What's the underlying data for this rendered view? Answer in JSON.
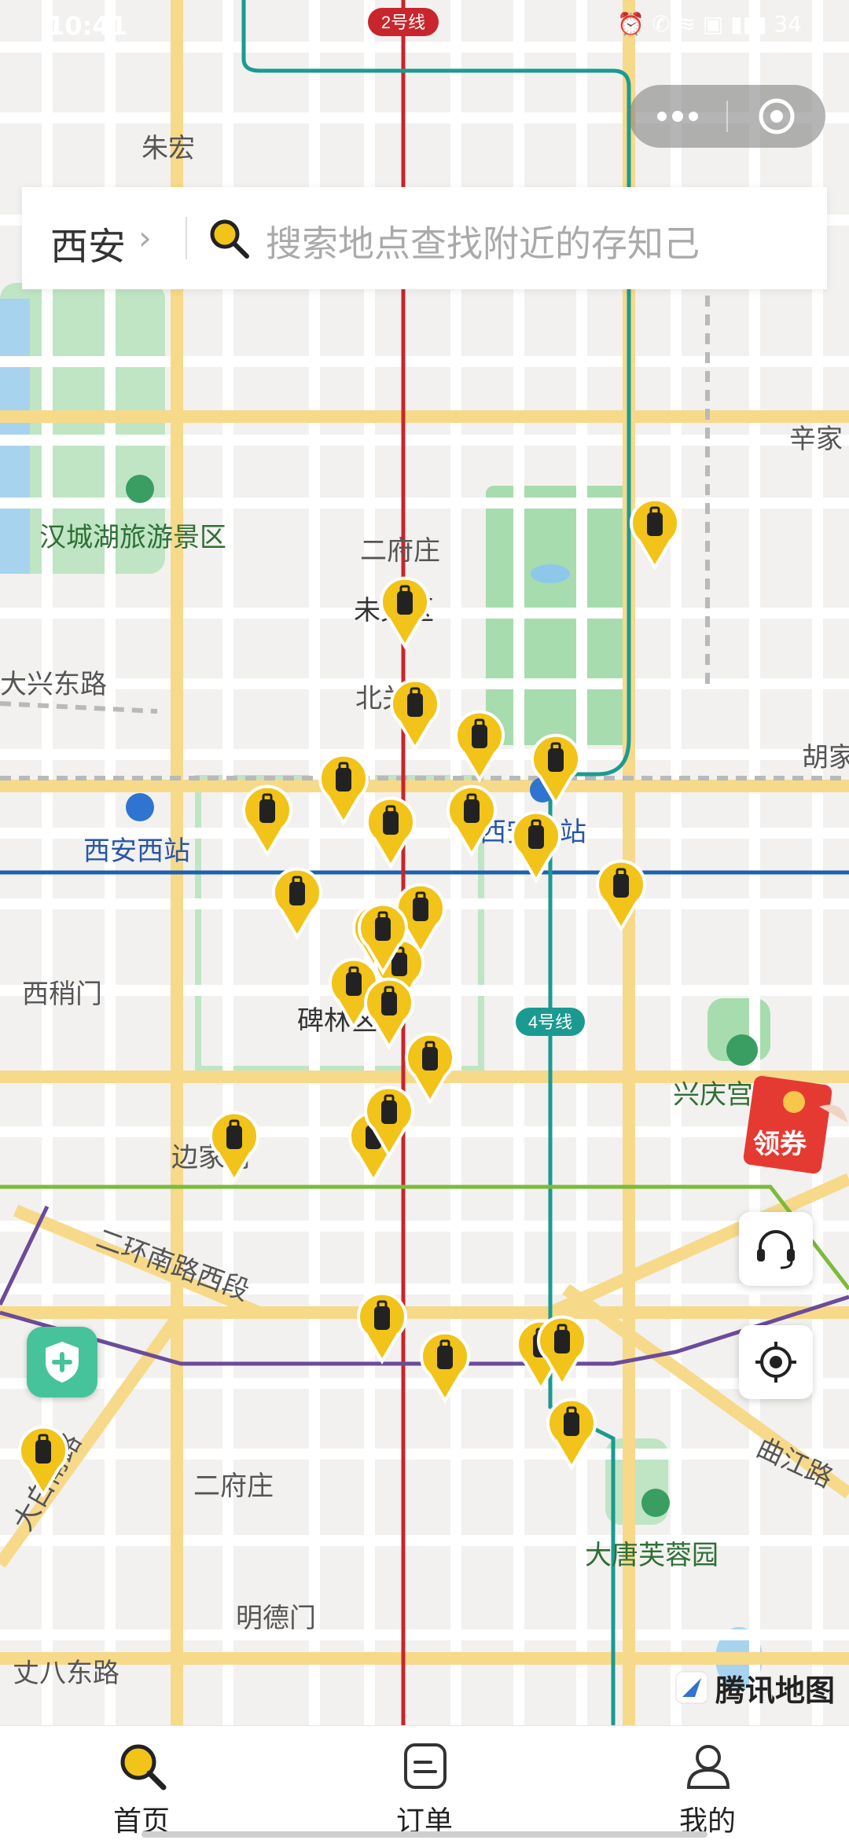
{
  "status": {
    "time": "10:41",
    "icons": "⏰ ✆ ≋ ▣ ▮▮▮ 34"
  },
  "capsule": {
    "more_label": "•••",
    "close_label": "◎"
  },
  "search": {
    "city": "西安",
    "chevron": "›",
    "placeholder": "搜索地点查找附近的存知己"
  },
  "map": {
    "metro_badges": [
      "2号线",
      "4号线"
    ],
    "labels": [
      "朱宏",
      "汉城湖旅游景区",
      "二府庄",
      "未央区",
      "大兴东路",
      "北关",
      "胡家",
      "辛家",
      "西安西站",
      "西安北站",
      "西稍门",
      "碑林区",
      "兴庆宫",
      "边家村",
      "二环南路西段",
      "大白南路",
      "二府庄",
      "大唐芙蓉园",
      "曲江路",
      "明德门",
      "丈八东路"
    ],
    "pin_count": 30,
    "attribution": "腾讯地图"
  },
  "coupon": {
    "label": "领券"
  },
  "tabs": [
    {
      "label": "首页",
      "icon": "search-icon",
      "active": true
    },
    {
      "label": "订单",
      "icon": "order-icon",
      "active": false
    },
    {
      "label": "我的",
      "icon": "user-icon",
      "active": false
    }
  ],
  "colors": {
    "accent": "#f2c318",
    "line2": "#c8252c",
    "line4": "#1b9a91",
    "line1": "#1d5fb0",
    "road": "#f7d98a"
  }
}
